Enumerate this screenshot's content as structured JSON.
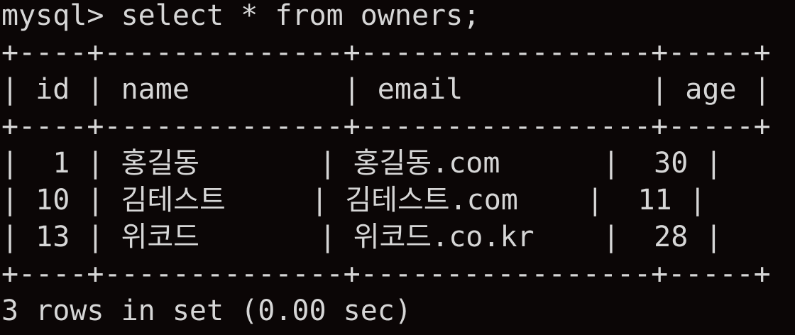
{
  "terminal": {
    "prompt": "mysql> ",
    "command": "select * from owners;",
    "border": "+----+--------------+-----------------+-----+",
    "header_row": "| id | name         | email           | age |",
    "rows": [
      "|  1 | 홍길동       | 홍길동.com      |  30 |",
      "| 10 | 김테스트     | 김테스트.com    |  11 |",
      "| 13 | 위코드       | 위코드.co.kr    |  28 |"
    ],
    "result_summary": "3 rows in set (0.00 sec)"
  },
  "colors": {
    "background": "#0b0606",
    "foreground": "#d6d6d6"
  }
}
